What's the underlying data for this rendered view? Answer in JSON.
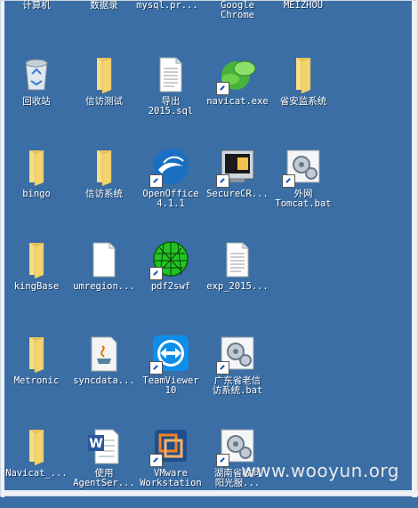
{
  "top_row": [
    {
      "name": "computer",
      "label": "计算机"
    },
    {
      "name": "data-record",
      "label": "数据录"
    },
    {
      "name": "mysql-pr",
      "label": "mysql.pr..."
    },
    {
      "name": "google-chrome",
      "label": "Google\nChrome"
    },
    {
      "name": "meizhou",
      "label": "MEIZHOU"
    }
  ],
  "icons": [
    {
      "id": "recycle-bin",
      "label": "回收站",
      "icon": "recycle-bin-icon"
    },
    {
      "id": "xinfang-test",
      "label": "信访测试",
      "icon": "folder-icon"
    },
    {
      "id": "export-2015-sql",
      "label": "导出\n2015.sql",
      "icon": "text-file-icon"
    },
    {
      "id": "navicat-exe",
      "label": "navicat.exe",
      "icon": "navicat-icon"
    },
    {
      "id": "provincial-monitor",
      "label": "省安监系统",
      "icon": "folder-icon"
    },
    {
      "id": "bingo",
      "label": "bingo",
      "icon": "folder-icon"
    },
    {
      "id": "xinfang-system",
      "label": "信访系统",
      "icon": "folder-icon"
    },
    {
      "id": "openoffice",
      "label": "OpenOffice\n4.1.1",
      "icon": "openoffice-icon"
    },
    {
      "id": "securecrt",
      "label": "SecureCR...",
      "icon": "securecrt-icon"
    },
    {
      "id": "external-tomcat",
      "label": "外网\nTomcat.bat",
      "icon": "bat-icon"
    },
    {
      "id": "kingbase",
      "label": "kingBase",
      "icon": "folder-icon"
    },
    {
      "id": "umregion",
      "label": "umregion...",
      "icon": "blank-file-icon"
    },
    {
      "id": "pdf2swf",
      "label": "pdf2swf",
      "icon": "pdf2swf-icon"
    },
    {
      "id": "exp-2015",
      "label": "exp_2015...",
      "icon": "text-file-icon"
    },
    {
      "id": "metronic",
      "label": "Metronic",
      "icon": "folder-icon"
    },
    {
      "id": "syncdata",
      "label": "syncdata...",
      "icon": "java-file-icon"
    },
    {
      "id": "teamviewer",
      "label": "TeamViewer\n10",
      "icon": "teamviewer-icon"
    },
    {
      "id": "guangdong-system",
      "label": "广东省老信\n访系统.bat",
      "icon": "bat-icon"
    },
    {
      "id": "navicat-folder",
      "label": "Navicat_...",
      "icon": "folder-icon"
    },
    {
      "id": "agentser",
      "label": "使用\nAgentSer...",
      "icon": "word-doc-icon"
    },
    {
      "id": "vmware",
      "label": "VMware\nWorkstation",
      "icon": "vmware-icon"
    },
    {
      "id": "hunan-server",
      "label": "湖南省敏同\n阳光服...",
      "icon": "bat-icon"
    }
  ],
  "watermark": "www.wooyun.org",
  "colors": {
    "desktop": "#3a6ea5",
    "folder": "#f3d46d",
    "text": "#ffffff"
  }
}
